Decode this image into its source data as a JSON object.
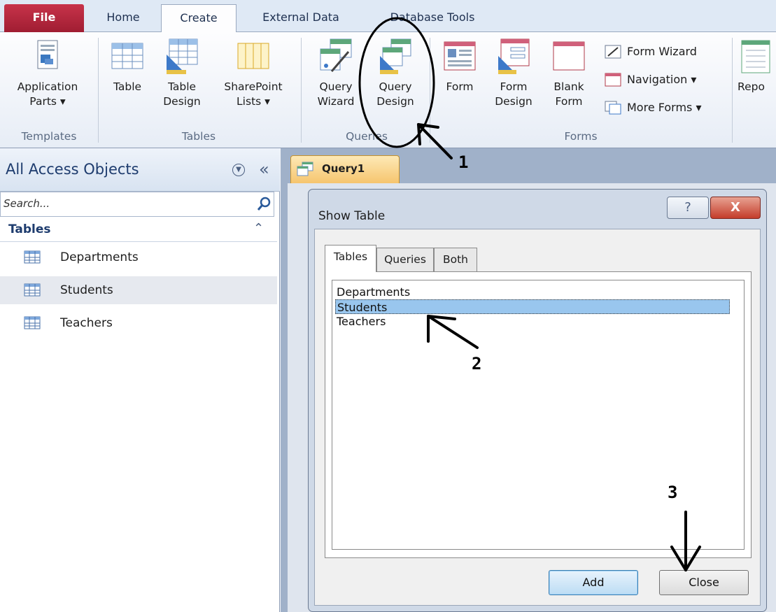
{
  "ribbon": {
    "tabs": [
      {
        "label": "File"
      },
      {
        "label": "Home"
      },
      {
        "label": "Create"
      },
      {
        "label": "External Data"
      },
      {
        "label": "Database Tools"
      }
    ],
    "buttons": {
      "application_parts": [
        "Application",
        "Parts ▾"
      ],
      "table": [
        "Table"
      ],
      "table_design": [
        "Table",
        "Design"
      ],
      "sharepoint_lists": [
        "SharePoint",
        "Lists ▾"
      ],
      "query_wizard": [
        "Query",
        "Wizard"
      ],
      "query_design": [
        "Query",
        "Design"
      ],
      "form": [
        "Form"
      ],
      "form_design": [
        "Form",
        "Design"
      ],
      "blank_form": [
        "Blank",
        "Form"
      ],
      "form_wizard": "Form Wizard",
      "navigation": "Navigation ▾",
      "more_forms": "More Forms ▾",
      "report_partial": "Repo"
    },
    "groups": {
      "templates": "Templates",
      "tables": "Tables",
      "queries": "Queries",
      "forms": "Forms"
    }
  },
  "nav_pane": {
    "title": "All Access Objects",
    "collapse_glyph": "«",
    "search_placeholder": "Search...",
    "group_label": "Tables",
    "group_toggle_glyph": "⌃",
    "items": [
      {
        "label": "Departments",
        "selected": false
      },
      {
        "label": "Students",
        "selected": true
      },
      {
        "label": "Teachers",
        "selected": false
      }
    ]
  },
  "document_tab": {
    "label": "Query1"
  },
  "dialog": {
    "title": "Show Table",
    "help_glyph": "?",
    "close_glyph": "X",
    "tabs": [
      {
        "label": "Tables",
        "active": true
      },
      {
        "label": "Queries",
        "active": false
      },
      {
        "label": "Both",
        "active": false
      }
    ],
    "list_items": [
      {
        "label": "Departments",
        "selected": false
      },
      {
        "label": "Students",
        "selected": true
      },
      {
        "label": "Teachers",
        "selected": false
      }
    ],
    "add_label": "Add",
    "close_label": "Close"
  },
  "annotations": {
    "step1": "1",
    "step2": "2",
    "step3": "3"
  },
  "colors": {
    "file_tab": "#b8273e",
    "selection": "#99c6ee",
    "document_tab": "#f6c56e"
  }
}
